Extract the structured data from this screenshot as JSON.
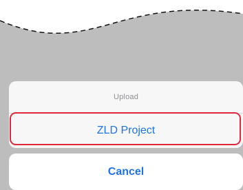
{
  "action_sheet": {
    "title": "Upload",
    "option_label": "ZLD Project"
  },
  "cancel_label": "Cancel",
  "colors": {
    "accent": "#1e73e8",
    "highlight": "#e0283b",
    "sheet_bg": "#f7f7f7",
    "backdrop": "#bdbdbd"
  }
}
